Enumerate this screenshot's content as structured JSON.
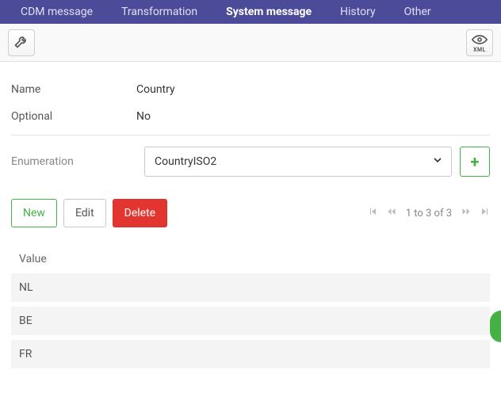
{
  "topnav": {
    "tabs": [
      {
        "label": "CDM message",
        "active": false
      },
      {
        "label": "Transformation",
        "active": false
      },
      {
        "label": "System message",
        "active": true
      },
      {
        "label": "History",
        "active": false
      },
      {
        "label": "Other",
        "active": false
      }
    ]
  },
  "toolbar": {
    "wrench_icon": "wrench-icon",
    "xml_icon_label": "XML"
  },
  "details": {
    "name_label": "Name",
    "name_value": "Country",
    "optional_label": "Optional",
    "optional_value": "No",
    "enum_label": "Enumeration",
    "enum_selected": "CountryISO2"
  },
  "actions": {
    "new_label": "New",
    "edit_label": "Edit",
    "delete_label": "Delete"
  },
  "pagination": {
    "text": "1 to 3 of 3"
  },
  "table": {
    "header": "Value",
    "rows": [
      "NL",
      "BE",
      "FR"
    ]
  }
}
